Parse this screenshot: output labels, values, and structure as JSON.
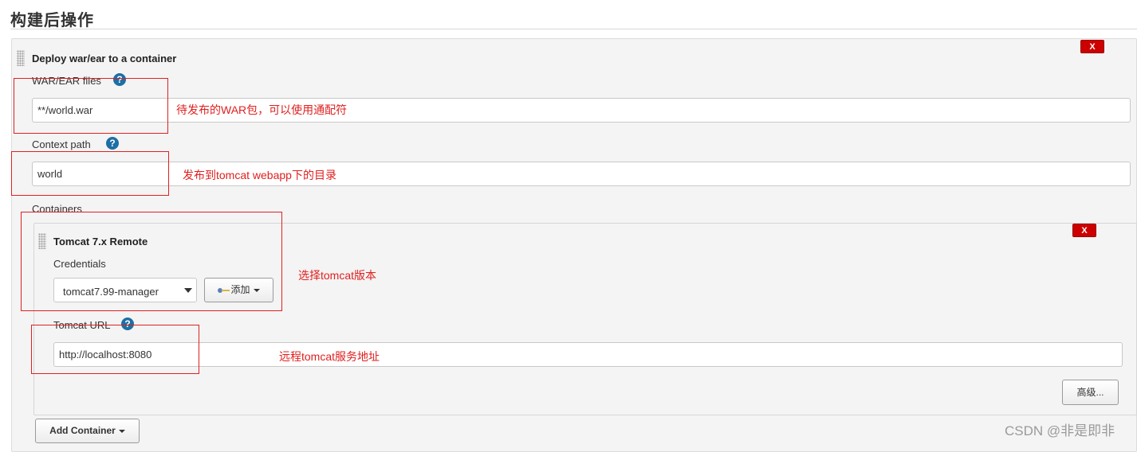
{
  "section": {
    "title": "构建后操作"
  },
  "deploy": {
    "heading": "Deploy war/ear to a container",
    "delete_label": "X",
    "war_label": "WAR/EAR files",
    "war_value": "**/world.war",
    "context_label": "Context path",
    "context_value": "world",
    "containers_label": "Containers",
    "add_container_label": "Add Container"
  },
  "container": {
    "heading": "Tomcat 7.x Remote",
    "delete_label": "X",
    "credentials_label": "Credentials",
    "credentials_selected": "tomcat7.99-manager",
    "add_label": "添加",
    "url_label": "Tomcat URL",
    "url_value": "http://localhost:8080",
    "advanced_label": "高级..."
  },
  "help": {
    "glyph": "?"
  },
  "annotations": {
    "war": "待发布的WAR包，可以使用通配符",
    "context": "发布到tomcat webapp下的目录",
    "version": "选择tomcat版本",
    "url": "远程tomcat服务地址"
  },
  "watermark": "CSDN @非是即非",
  "colors": {
    "annotation_red": "#e02020",
    "delete_red": "#cc0000",
    "help_blue": "#1d6fa5"
  },
  "icons": [
    "drag-handle-icon",
    "help-icon",
    "key-icon",
    "caret-down-icon"
  ]
}
